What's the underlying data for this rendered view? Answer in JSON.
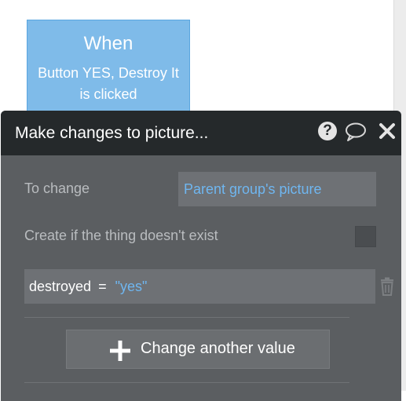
{
  "event_card": {
    "title": "When",
    "description": "Button YES, Destroy It is clicked"
  },
  "action_panel": {
    "title": "Make changes to picture...",
    "help_glyph": "?",
    "icons": [
      "help-icon",
      "comment-icon",
      "close-icon"
    ],
    "to_change_label": "To change",
    "to_change_value": "Parent group's picture",
    "create_label": "Create if the thing doesn't exist",
    "create_checked": false,
    "assignment": {
      "field": "destroyed",
      "operator": "=",
      "value": "\"yes\""
    },
    "add_button_label": "Change another value"
  },
  "colors": {
    "event_card_bg": "#7fbbe9",
    "panel_bg": "#5b5e61",
    "panel_header_bg": "#25292b",
    "link_blue": "#6fb6f0"
  }
}
